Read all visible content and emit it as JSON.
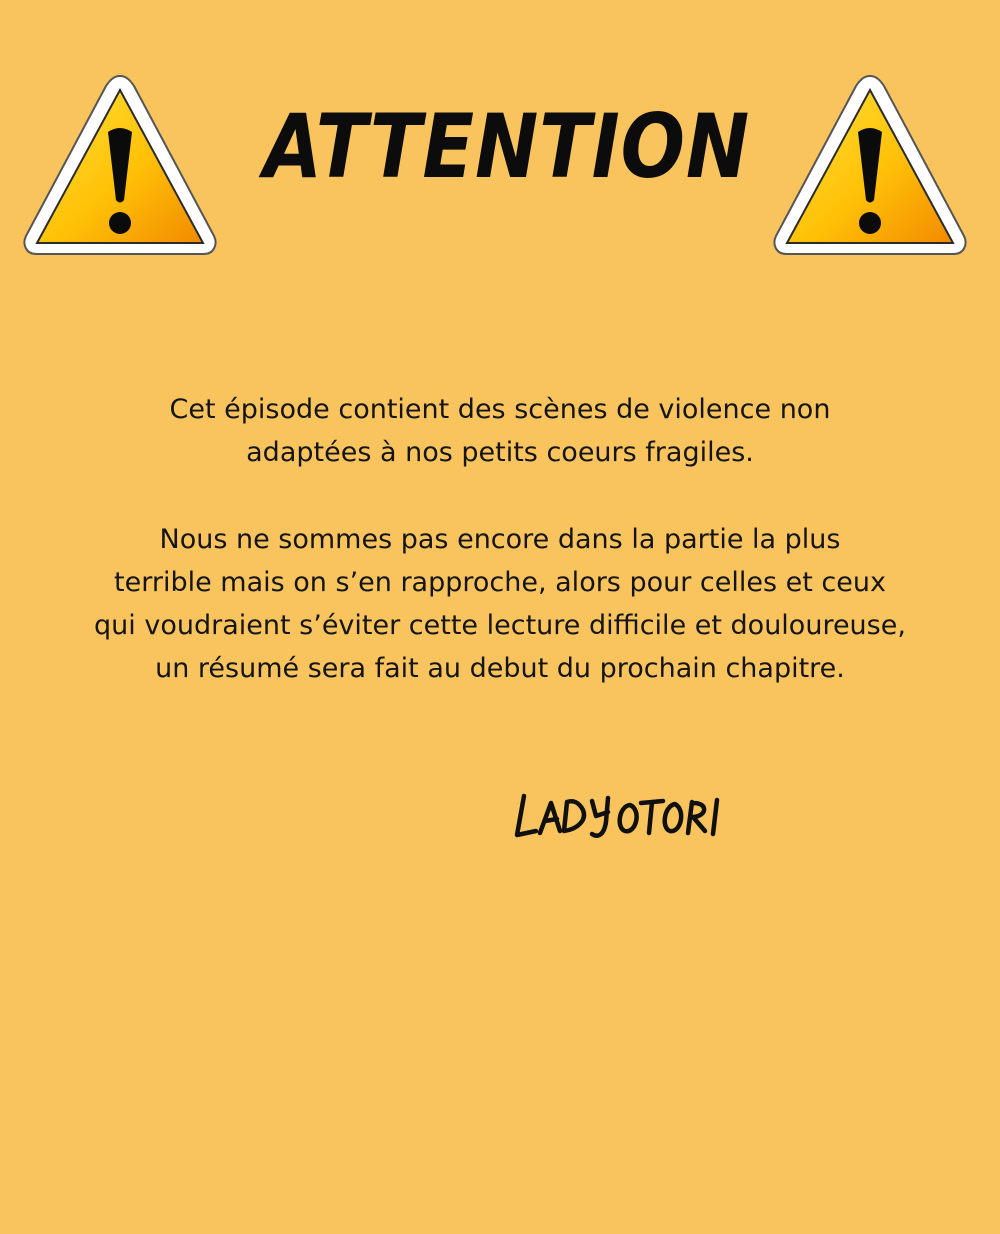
{
  "header": {
    "title": "ATTENTION",
    "icon_left": "warning-triangle-icon",
    "icon_right": "warning-triangle-icon"
  },
  "message": {
    "paragraph_1": [
      "Cet épisode contient des scènes de violence non",
      "adaptées à nos petits coeurs fragiles."
    ],
    "paragraph_2": [
      "Nous ne sommes pas encore dans la partie la plus",
      "terrible mais on s’en rapproche, alors pour celles et ceux",
      "qui voudraient s’éviter cette lecture difficile et douloureuse,",
      "un résumé sera fait au debut du prochain chapitre."
    ]
  },
  "signature": {
    "text": "LADY OTORI"
  },
  "colors": {
    "background": "#f9c45e",
    "triangle_fill_top": "#ffd21c",
    "triangle_fill_bottom": "#f28a00",
    "text": "#151515"
  }
}
